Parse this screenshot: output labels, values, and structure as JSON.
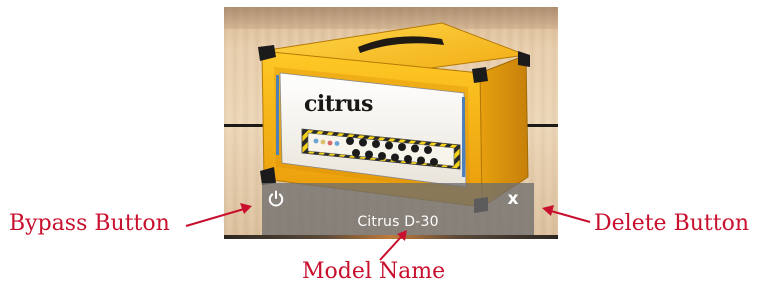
{
  "amp": {
    "logo_text": "citrus",
    "model_name": "Citrus D-30"
  },
  "controls": {
    "bypass_icon": "power-icon",
    "delete_label": "x"
  },
  "callouts": {
    "bypass": "Bypass Button",
    "delete": "Delete Button",
    "model": "Model Name"
  },
  "colors": {
    "callout": "#c8102e",
    "amp_body": "#f2b61a",
    "control_bar": "#6e6e6e"
  }
}
